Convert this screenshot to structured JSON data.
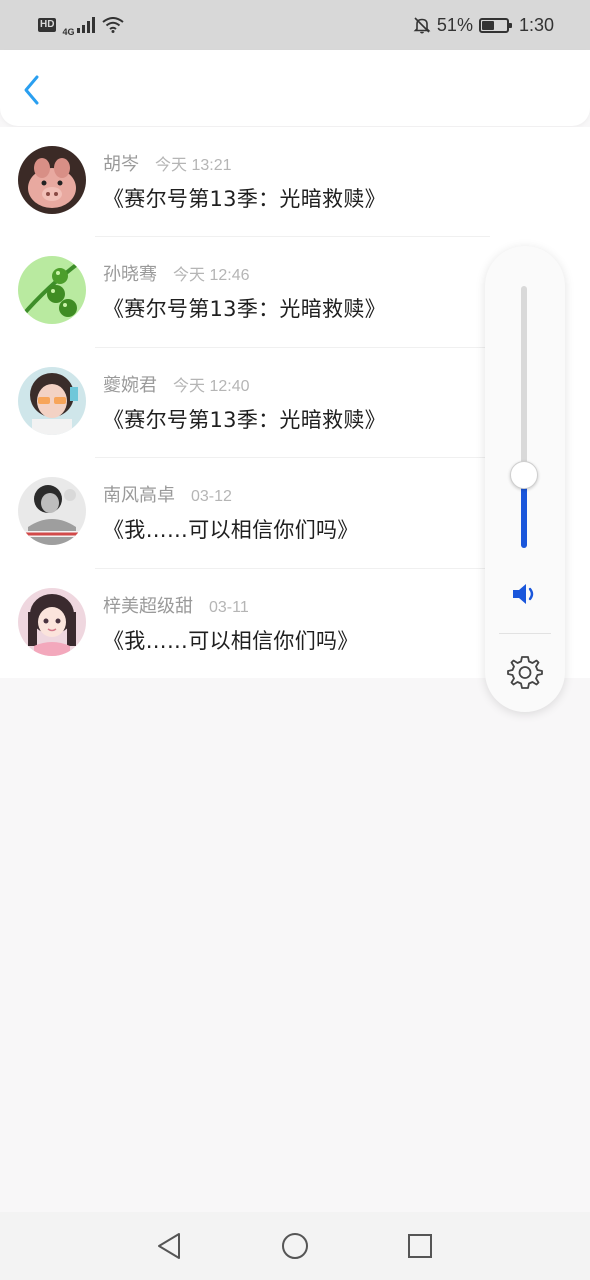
{
  "status_bar": {
    "hd": "HD",
    "network_type": "4G",
    "battery_percent": "51%",
    "battery_level": 0.51,
    "time": "1:30",
    "icons": [
      "hd-icon",
      "signal-icon",
      "wifi-icon",
      "mute-bell-icon",
      "battery-icon"
    ]
  },
  "header": {
    "back_icon": "chevron-left-icon",
    "accent_color": "#2a9ff0"
  },
  "messages": [
    {
      "name": "胡岑",
      "time": "今天 13:21",
      "text": "《赛尔号第13季：光暗救赎》",
      "avatar": "pig-avatar"
    },
    {
      "name": "孙晓骞",
      "time": "今天 12:46",
      "text": "《赛尔号第13季：光暗救赎》",
      "avatar": "green-fruit-avatar"
    },
    {
      "name": "夔婉君",
      "time": "今天 12:40",
      "text": "《赛尔号第13季：光暗救赎》",
      "avatar": "girl-avatar"
    },
    {
      "name": "南风高卓",
      "time": "03-12",
      "text": "《我……可以相信你们吗》",
      "avatar": "bw-photo-avatar"
    },
    {
      "name": "梓美超级甜",
      "time": "03-11",
      "text": "《我……可以相信你们吗》",
      "avatar": "anime-girl-avatar"
    }
  ],
  "volume_panel": {
    "level": 0.28,
    "accent_color": "#1a56db",
    "speaker_icon": "speaker-icon",
    "settings_icon": "gear-icon"
  },
  "nav_bar": {
    "icons": [
      "back-triangle-icon",
      "home-circle-icon",
      "recents-square-icon"
    ]
  }
}
